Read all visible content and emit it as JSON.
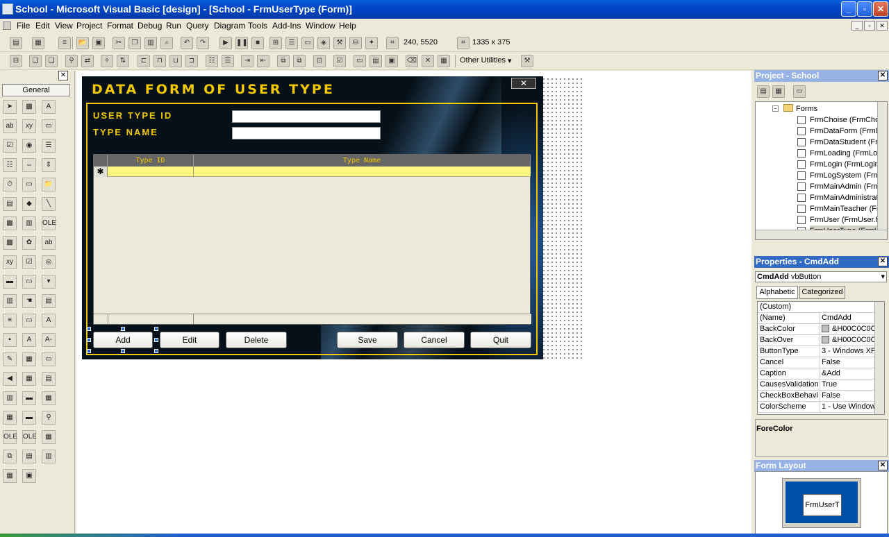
{
  "window": {
    "title": "School - Microsoft Visual Basic [design] - [School - FrmUserType (Form)]",
    "controls": [
      "_",
      "▫",
      "✕"
    ]
  },
  "menu": {
    "items": [
      "File",
      "Edit",
      "View",
      "Project",
      "Format",
      "Debug",
      "Run",
      "Query",
      "Diagram",
      "Tools",
      "Add-Ins",
      "Window",
      "Help"
    ],
    "mdi_controls": [
      "_",
      "▫",
      "✕"
    ]
  },
  "toolbar": {
    "position": "240, 5520",
    "size": "1335 x 375",
    "other_utilities": "Other Utilities"
  },
  "toolbox": {
    "tab": "General",
    "close": "✕"
  },
  "form": {
    "title": "DATA FORM OF USER TYPE",
    "close": "✕",
    "user_type_id_label": "USER TYPE ID",
    "type_name_label": "TYPE NAME",
    "grid": {
      "columns": [
        "Type ID",
        "Type Name"
      ],
      "new_row_marker": "✱"
    },
    "buttons": {
      "add": "Add",
      "edit": "Edit",
      "delete": "Delete",
      "save": "Save",
      "cancel": "Cancel",
      "quit": "Quit"
    }
  },
  "project_panel": {
    "title": "Project - School",
    "folder": "Forms",
    "items": [
      "FrmChoise (FrmChoi",
      "FrmDataForm (FrmD",
      "FrmDataStudent (Fr",
      "FrmLoading (FrmLoa",
      "FrmLogin (FrmLogin.",
      "FrmLogSystem (Frm",
      "FrmMainAdmin (Frml",
      "FrmMainAdministrati",
      "FrmMainTeacher (Fr",
      "FrmUser (FrmUser.f",
      "FrmUserType (FrmU"
    ]
  },
  "properties_panel": {
    "title": "Properties - CmdAdd",
    "object_name": "CmdAdd",
    "object_type": "vbButton",
    "tabs": [
      "Alphabetic",
      "Categorized"
    ],
    "rows": [
      {
        "name": "(Custom)",
        "value": ""
      },
      {
        "name": "(Name)",
        "value": "CmdAdd"
      },
      {
        "name": "BackColor",
        "value": "&H00C0C0C"
      },
      {
        "name": "BackOver",
        "value": "&H00C0C0C"
      },
      {
        "name": "ButtonType",
        "value": "3 - Windows XP"
      },
      {
        "name": "Cancel",
        "value": "False"
      },
      {
        "name": "Caption",
        "value": "&Add"
      },
      {
        "name": "CausesValidation",
        "value": "True"
      },
      {
        "name": "CheckBoxBehavic",
        "value": "False"
      },
      {
        "name": "ColorScheme",
        "value": "1 - Use Window:"
      }
    ],
    "description_title": "ForeColor"
  },
  "form_layout_panel": {
    "title": "Form Layout",
    "mini_form": "FrmUserT"
  }
}
